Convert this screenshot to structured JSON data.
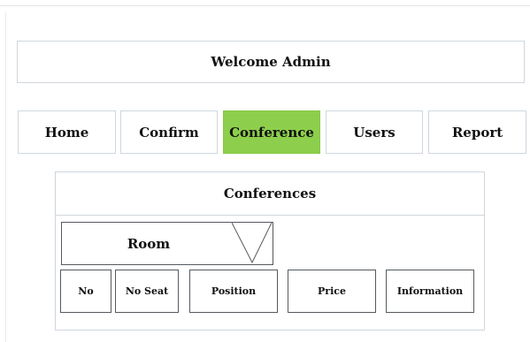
{
  "header": {
    "welcome_text": "Welcome Admin"
  },
  "nav": {
    "items": [
      {
        "label": "Home",
        "active": false
      },
      {
        "label": "Confirm",
        "active": false
      },
      {
        "label": "Conference",
        "active": true
      },
      {
        "label": "Users",
        "active": false
      },
      {
        "label": "Report",
        "active": false
      }
    ],
    "active_color": "#8dcf4c"
  },
  "conferences": {
    "title": "Conferences",
    "room_select": {
      "label": "Room",
      "icon": "dropdown-triangle-icon"
    },
    "columns": [
      "No",
      "No Seat",
      "Position",
      "Price",
      "Information"
    ]
  }
}
